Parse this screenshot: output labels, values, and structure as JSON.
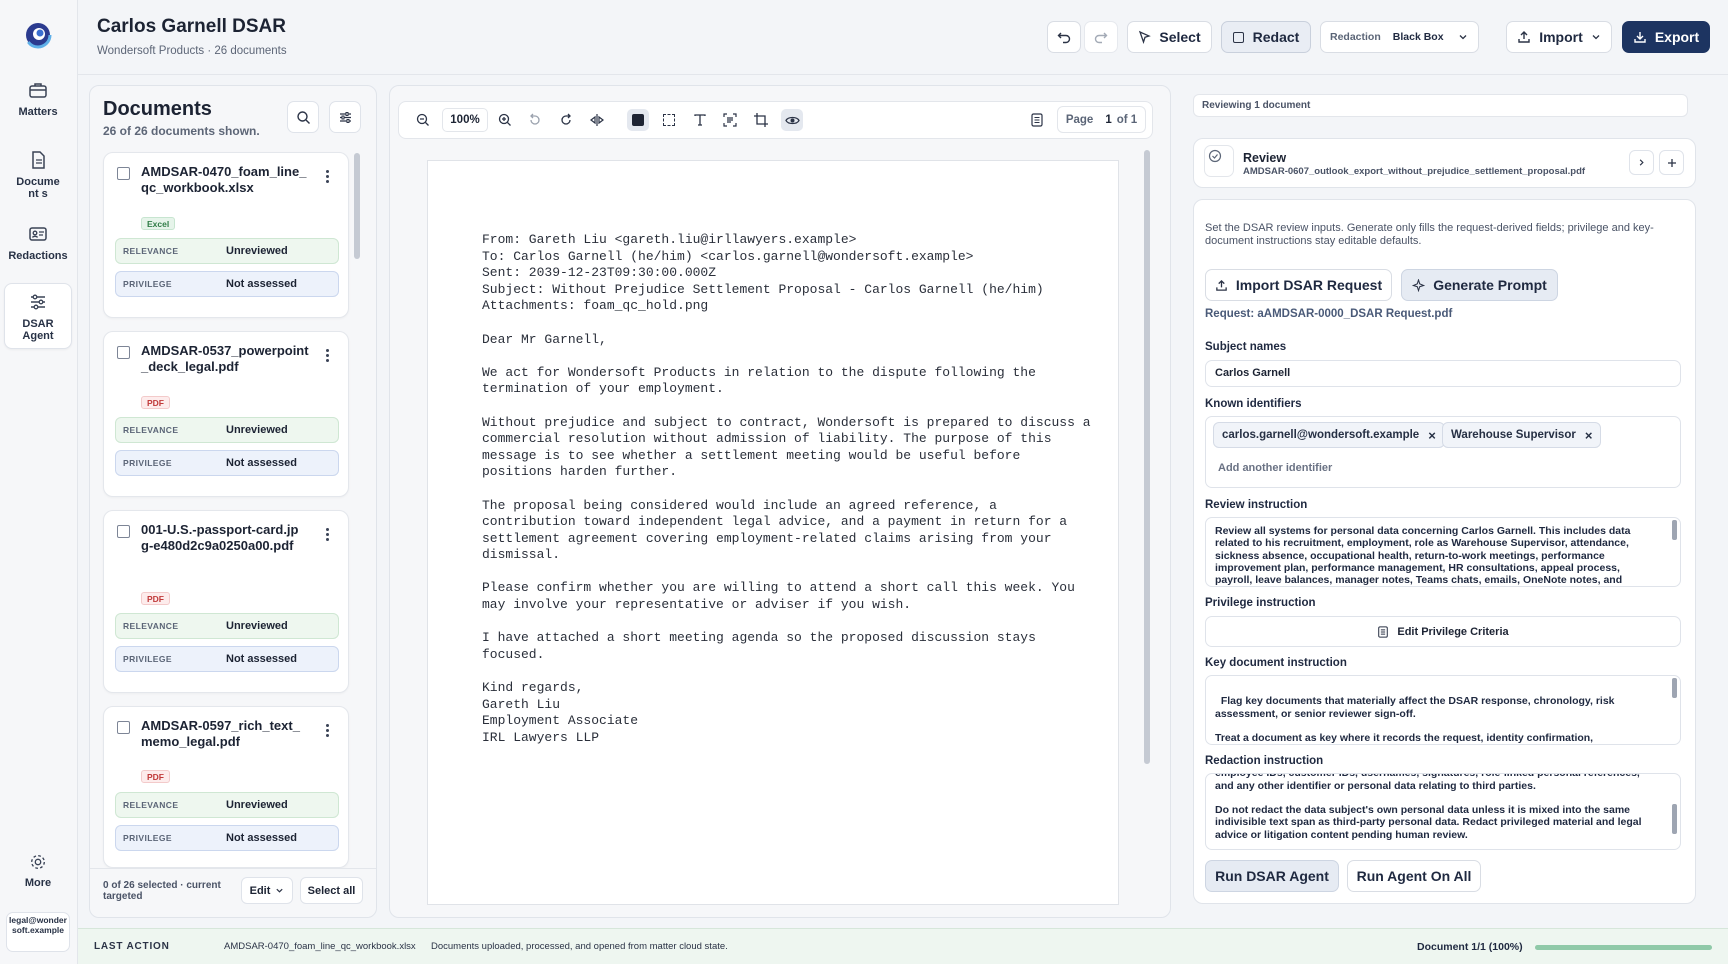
{
  "nav": {
    "items": [
      {
        "label": "Matters",
        "icon": "briefcase-icon"
      },
      {
        "label": "Document s",
        "icon": "document-icon"
      },
      {
        "label": "Redactions",
        "icon": "id-card-icon"
      },
      {
        "label": "DSAR Agent",
        "icon": "sliders-icon"
      }
    ],
    "more_label": "More",
    "user_email": "legal@wondersoft.example"
  },
  "header": {
    "title": "Carlos Garnell DSAR",
    "subtitle": "Wondersoft Products · 26 documents",
    "select_label": "Select",
    "redact_label": "Redact",
    "redaction_label": "Redaction",
    "redaction_value": "Black Box",
    "import_label": "Import",
    "export_label": "Export"
  },
  "documents": {
    "heading": "Documents",
    "count_text": "26 of 26 documents shown.",
    "relevance_key": "RELEVANCE",
    "privilege_key": "PRIVILEGE",
    "items": [
      {
        "name": "AMDSAR-0470_foam_line_qc_workbook.xlsx",
        "type": "Excel",
        "relevance": "Unreviewed",
        "privilege": "Not assessed"
      },
      {
        "name": "AMDSAR-0537_powerpoint_deck_legal.pdf",
        "type": "PDF",
        "relevance": "Unreviewed",
        "privilege": "Not assessed"
      },
      {
        "name": "001-U.S.-passport-card.jpg-e480d2c9a0250a00.pdf",
        "type": "PDF",
        "relevance": "Unreviewed",
        "privilege": "Not assessed"
      },
      {
        "name": "AMDSAR-0597_rich_text_memo_legal.pdf",
        "type": "PDF",
        "relevance": "Unreviewed",
        "privilege": "Not assessed"
      }
    ],
    "selection_text": "0 of 26 selected · current targeted",
    "edit_label": "Edit",
    "select_all_label": "Select all"
  },
  "viewer": {
    "zoom": "100%",
    "page_label": "Page",
    "page_current": "1",
    "page_of": "of 1",
    "document_text": "From: Gareth Liu <gareth.liu@irllawyers.example>\nTo: Carlos Garnell (he/him) <carlos.garnell@wondersoft.example>\nSent: 2039-12-23T09:30:00.000Z\nSubject: Without Prejudice Settlement Proposal - Carlos Garnell (he/him)\nAttachments: foam_qc_hold.png\n\nDear Mr Garnell,\n\nWe act for Wondersoft Products in relation to the dispute following the\ntermination of your employment.\n\nWithout prejudice and subject to contract, Wondersoft is prepared to discuss a\ncommercial resolution without admission of liability. The purpose of this\nmessage is to see whether a settlement meeting would be useful before\npositions harden further.\n\nThe proposal being considered would include an agreed reference, a\ncontribution toward independent legal advice, and a payment in return for a\nsettlement agreement covering employment-related claims arising from your\ndismissal.\n\nPlease confirm whether you are willing to attend a short call this week. You\nmay involve your representative or adviser if you wish.\n\nI have attached a short meeting agenda so the proposed discussion stays\nfocused.\n\nKind regards,\nGareth Liu\nEmployment Associate\nIRL Lawyers LLP"
  },
  "agent": {
    "reviewing_text": "Reviewing 1 document",
    "review_title": "Review",
    "review_file": "AMDSAR-0607_outlook_export_without_prejudice_settlement_proposal.pdf",
    "intro": "Set the DSAR review inputs. Generate only fills the request-derived fields; privilege and key-document instructions stay editable defaults.",
    "import_request_label": "Import DSAR Request",
    "generate_prompt_label": "Generate Prompt",
    "request_text": "Request: aAMDSAR-0000_DSAR Request.pdf",
    "subject_names_label": "Subject names",
    "subject_names_value": "Carlos Garnell",
    "known_identifiers_label": "Known identifiers",
    "identifiers": [
      "carlos.garnell@wondersoft.example",
      "Warehouse Supervisor"
    ],
    "identifier_placeholder": "Add another identifier",
    "review_instruction_label": "Review instruction",
    "review_instruction": "Review all systems for personal data concerning Carlos Garnell. This includes data related to his recruitment, employment, role as Warehouse Supervisor, attendance, sickness absence, occupational health, return-to-work meetings, performance improvement plan, performance management, HR consultations, appeal process, payroll, leave balances, manager notes, Teams chats, emails, OneNote notes, and",
    "privilege_instruction_label": "Privilege instruction",
    "edit_privilege_label": "Edit Privilege Criteria",
    "key_document_label": "Key document instruction",
    "key_document_instruction": "Flag key documents that materially affect the DSAR response, chronology, risk assessment, or senior reviewer sign-off.\n\nTreat a document as key where it records the request, identity confirmation, employment decision, grievance, disciplinary action, dismissal, appeal,",
    "redaction_instruction_label": "Redaction instruction",
    "redaction_instruction": "employee IDs, customer IDs, usernames, signatures, role-linked personal references, and any other identifier or personal data relating to third parties.\n\nDo not redact the data subject's own personal data unless it is mixed into the same indivisible text span as third-party personal data. Redact privileged material and legal advice or litigation content pending human review.",
    "run_agent_label": "Run DSAR Agent",
    "run_all_label": "Run Agent On All"
  },
  "status_bar": {
    "last_action_label": "LAST ACTION",
    "last_action_file": "AMDSAR-0470_foam_line_qc_workbook.xlsx",
    "last_action_text": "Documents uploaded, processed, and opened from matter cloud state.",
    "progress_text": "Document 1/1 (100%)",
    "progress": 1.0
  },
  "colors": {
    "accent": "#1d3461",
    "relevance_bg": "#eef7ef",
    "privilege_bg": "#edf2fb",
    "progress": "#8fc9a8"
  }
}
